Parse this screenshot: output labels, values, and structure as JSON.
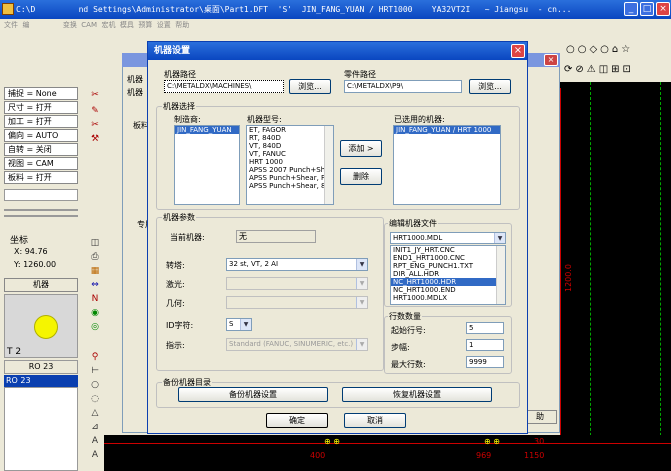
{
  "app": {
    "title": "C:\\D         nd Settings\\Administrator\\桌面\\Part1.DFT  'S'  JIN_FANG_YUAN / HRT1000    YA32VT2I   ~ Jiangsu  - cn...",
    "menu": "文件  编               变换  CAM  宏机  模具  预算  设置  帮助"
  },
  "left_panel": {
    "rows": [
      "捕捉 = None",
      "尺寸 = 打开",
      "加工 = 打开",
      "偏向 = AUTO",
      "自转 = 关闭",
      "视图 = CAM",
      "板料 = 打开"
    ],
    "coord_title": "坐标",
    "coord_x": "X:   94.76",
    "coord_y": "Y:  1260.00",
    "machine_label": "机器",
    "t_label": "T 2",
    "ro_button": "RO 23",
    "ro_item": "RO 23"
  },
  "canvas": {
    "dim_1200": "1200.0",
    "dim_400": "400",
    "dim_969": "969",
    "dim_1150": "1150",
    "dim_30": "30"
  },
  "behind": {
    "label1": "机器",
    "label2": "机器",
    "label3": "板料",
    "label4": "专用",
    "label5": "助"
  },
  "dialog": {
    "title": "机器设置",
    "machine_path_label": "机器路径",
    "machine_path_value": "C:\\METALDX\\MACHINES\\",
    "browse1": "浏览...",
    "part_path_label": "零件路径",
    "part_path_value": "C:\\METALDX\\P9\\",
    "browse2": "浏览...",
    "selection_group": "机器选择",
    "manufacturer_label": "制造商:",
    "manufacturers": [
      "JIN_FANG_YUAN"
    ],
    "model_label": "机器型号:",
    "models": [
      "ET, FAGOR",
      "RT, 840D",
      "VT, 840D",
      "VT, FANUC",
      "HRT 1000",
      "APSS 2007 Punch+She",
      "APSS Punch+Shear, FA",
      "APSS Punch+Shear, 84"
    ],
    "add_button": "添加 >",
    "delete_button": "删除",
    "used_label": "已选用的机器:",
    "used_machines": [
      "JIN_FANG_YUAN / HRT 1000"
    ],
    "params_group": "机器参数",
    "current_machine_label": "当前机器:",
    "current_machine_value": "无",
    "turret_label": "转塔:",
    "turret_value": "32 st, VT, 2 AI",
    "laser_label": "激光:",
    "geometry_label": "几何:",
    "id_label": "ID字符:",
    "id_value": "S",
    "cmd_label": "指示:",
    "cmd_value": "Standard (FANUC, SINUMERIC, etc.)",
    "edit_file_group": "编辑机器文件",
    "file_combo": "HRT1000.MDL",
    "files": [
      "INIT1_JY_HRT.CNC",
      "END1_HRT1000.CNC",
      "RPT_ENG_PUNCH1.TXT",
      "DIR_ALL.HDR",
      "NC_HRT1000.HDR",
      "NC_HRT1000.END",
      "HRT1000.MDLX"
    ],
    "rows_group": "行数数量",
    "start_row_label": "起始行号:",
    "start_row_value": "5",
    "step_label": "步幅:",
    "step_value": "1",
    "max_rows_label": "最大行数:",
    "max_rows_value": "9999",
    "backup_group": "备份机器目录",
    "backup_button": "备份机器设置",
    "restore_button": "恢复机器设置",
    "ok_button": "确定",
    "cancel_button": "取消"
  }
}
